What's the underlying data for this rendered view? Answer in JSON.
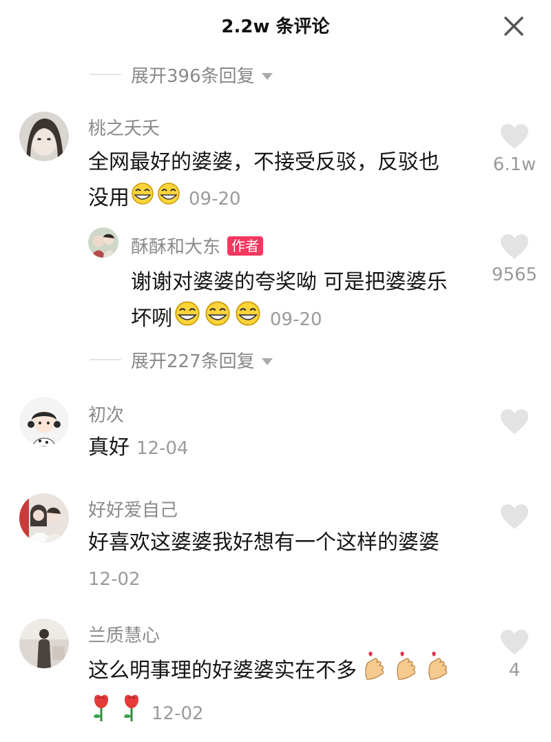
{
  "header": {
    "title": "2.2w 条评论",
    "close_icon": "close-icon"
  },
  "comments": [
    {
      "expand_replies": "展开396条回复",
      "username": "桃之夭夭",
      "text_line1": "全网最好的婆婆，不接受反驳，反驳也",
      "text_line2": "没用",
      "date": "09-20",
      "likes": "6.1w"
    },
    {
      "username": "酥酥和大东",
      "badge": "作者",
      "text_line1": "谢谢对婆婆的夸奖呦 可是把婆婆乐",
      "text_line2": "坏咧",
      "date": "09-20",
      "likes": "9565"
    },
    {
      "expand_replies": "展开227条回复",
      "username": "初次",
      "text_line1": "真好",
      "date": "12-04",
      "likes": ""
    },
    {
      "username": "好好爱自己",
      "text_line1": "好喜欢这婆婆我好想有一个这样的婆婆",
      "date": "12-02",
      "likes": ""
    },
    {
      "username": "兰质慧心",
      "text_line1": "这么明事理的好婆婆实在不多",
      "date": "12-02",
      "likes": "4"
    }
  ],
  "colors": {
    "badge": "#f4375f",
    "muted": "#9a9a9a",
    "heart": "#e3e3e3"
  }
}
